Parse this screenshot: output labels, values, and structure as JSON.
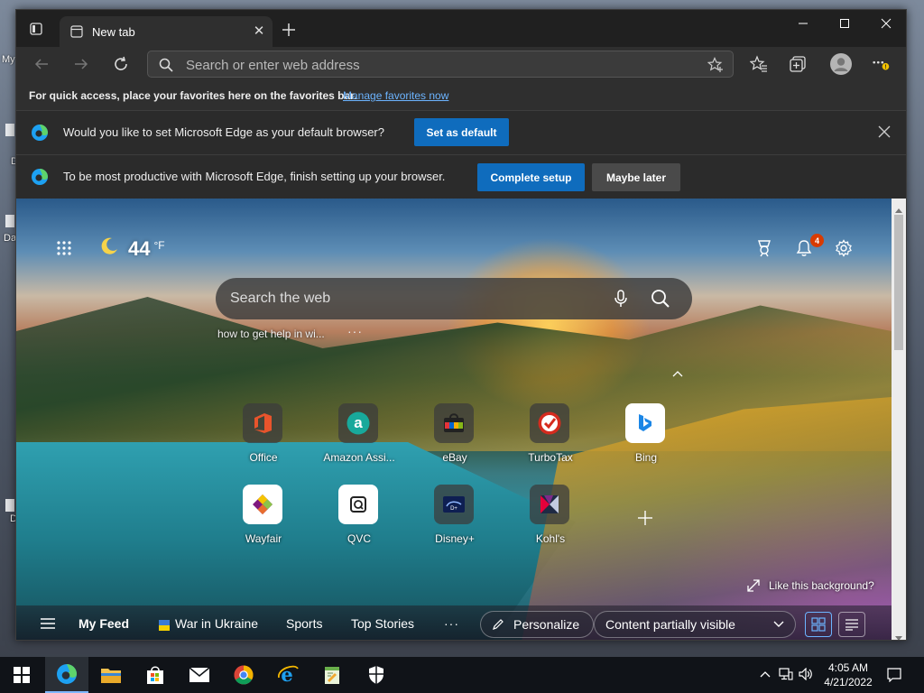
{
  "desktop": {
    "icon_labels": [
      "My",
      "D",
      "Da",
      "D"
    ]
  },
  "browser": {
    "tab": {
      "title": "New tab"
    },
    "address_bar": {
      "placeholder": "Search or enter web address",
      "value": ""
    },
    "favorites_bar": {
      "message": "For quick access, place your favorites here on the favorites bar.",
      "link": "Manage favorites now"
    },
    "notifications": [
      {
        "text": "Would you like to set Microsoft Edge as your default browser?",
        "primary": "Set as default"
      },
      {
        "text": "To be most productive with Microsoft Edge, finish setting up your browser.",
        "primary": "Complete setup",
        "secondary": "Maybe later"
      }
    ]
  },
  "ntp": {
    "weather": {
      "temp": "44",
      "unit": "°F",
      "icon": "moon-icon"
    },
    "notification_count": "4",
    "search": {
      "placeholder": "Search the web"
    },
    "recent_search": "how to get help in wi...",
    "recent_more": "···",
    "quick_links": [
      {
        "label": "Office",
        "icon": "office-icon"
      },
      {
        "label": "Amazon Assi...",
        "icon": "amazon-icon"
      },
      {
        "label": "eBay",
        "icon": "ebay-icon"
      },
      {
        "label": "TurboTax",
        "icon": "turbotax-icon"
      },
      {
        "label": "Bing",
        "icon": "bing-icon"
      },
      {
        "label": "Wayfair",
        "icon": "wayfair-icon"
      },
      {
        "label": "QVC",
        "icon": "qvc-icon"
      },
      {
        "label": "Disney+",
        "icon": "disney-icon"
      },
      {
        "label": "Kohl's",
        "icon": "kohls-icon"
      }
    ],
    "like_background": "Like this background?",
    "feed": {
      "my_feed": "My Feed",
      "items": [
        "War in Ukraine",
        "Sports",
        "Top Stories"
      ],
      "more": "···",
      "personalize": "Personalize",
      "visibility": "Content partially visible"
    }
  },
  "taskbar": {
    "time": "4:05 AM",
    "date": "4/21/2022"
  },
  "colors": {
    "accent_blue": "#0f6cbd",
    "link_blue": "#6cb4ff",
    "badge_red": "#d83b01"
  }
}
